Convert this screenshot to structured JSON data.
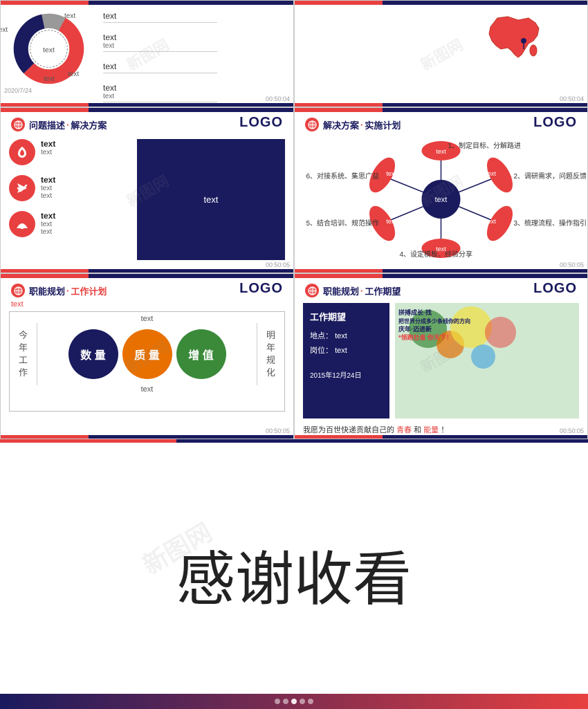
{
  "watermarks": [
    "新图网",
    "新图网",
    "新图网",
    "新图网",
    "新图网"
  ],
  "timestamps": [
    "00:50:04",
    "00:50:04",
    "00:50:05",
    "00:50:05",
    "00:50:05",
    "00:50:05"
  ],
  "date": "2020/7/24",
  "logo": "LOGO",
  "slide1": {
    "donut": {
      "segments": [
        "red",
        "darkblue",
        "gray",
        "lightblue"
      ],
      "labels": [
        "text",
        "text",
        "text",
        "text",
        "text"
      ]
    },
    "textItems": [
      {
        "label": "text",
        "sub": ""
      },
      {
        "label": "text",
        "sub": "text"
      },
      {
        "label": "text",
        "sub": ""
      },
      {
        "label": "text",
        "sub": "text"
      }
    ]
  },
  "slide2": {
    "title1": "问题描述",
    "sep": "·",
    "title2": "解决方案",
    "logo": "LOGO",
    "icons": [
      {
        "label": "text",
        "sub1": "text",
        "sub2": ""
      },
      {
        "label": "text",
        "sub1": "text",
        "sub2": "text"
      },
      {
        "label": "text",
        "sub1": "text",
        "sub2": "text"
      }
    ],
    "box_text": "text"
  },
  "slide3": {
    "title1": "解决方案",
    "sep": "·",
    "title2": "实施计划",
    "logo": "LOGO",
    "steps": [
      "1、制定目标、分解路进",
      "2、调研需求，问题反馈",
      "3、梳理流程、操作指引",
      "4、设定模板、经验分享",
      "5、结合培训、规范操作",
      "6、对接系统、集思广益"
    ],
    "center_text": "text",
    "petals": [
      "text",
      "text",
      "text",
      "text",
      "text",
      "text"
    ]
  },
  "slide4": {
    "title1": "职能规划",
    "sep": "·",
    "title2": "工作计划",
    "logo": "LOGO",
    "sub": "text",
    "top_label": "text",
    "circles": [
      "数 量",
      "质 量",
      "增 值"
    ],
    "left_labels": [
      "今",
      "年",
      "工",
      "作"
    ],
    "right_labels": [
      "明",
      "年",
      "规",
      "化"
    ],
    "bottom_label": "text"
  },
  "slide5": {
    "title1": "职能规划",
    "sep": "·",
    "title2": "工作期望",
    "logo": "LOGO",
    "box_title": "工作期望",
    "location_label": "地点：",
    "location_value": "text",
    "position_label": "岗位：",
    "position_value": "text",
    "date": "2015年12月24日",
    "wish1": "拼搏成长·找",
    "wish2": "把世界分成多少条线你的方向",
    "wish3": "庆年·迈进新",
    "wish4": "*领跑社者",
    "wish5": "你天下！",
    "bottom_text": "我愿为百世快递贡献自己的",
    "bottom_red1": "青春",
    "bottom_and": "和",
    "bottom_red2": "能量",
    "bottom_end": "！"
  },
  "thankyou": "感谢收看",
  "nav": {
    "prev": "◀",
    "next": "▶"
  }
}
